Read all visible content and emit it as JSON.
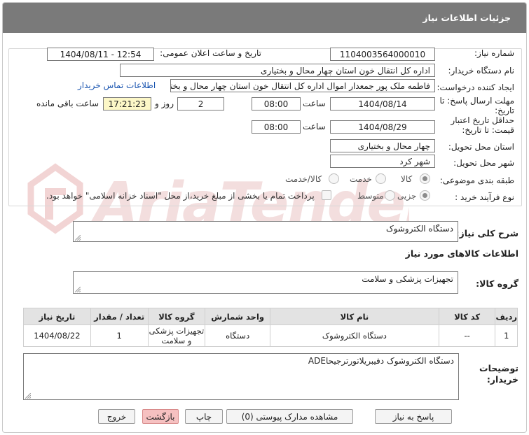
{
  "title": "جزئیات اطلاعات نیاز",
  "fields": {
    "need_number_label": "شماره نیاز:",
    "need_number": "1104003564000010",
    "announce_label": "تاریخ و ساعت اعلان عمومی:",
    "announce_value": "1404/08/11 - 12:54",
    "buyer_org_label": "نام دستگاه خریدار:",
    "buyer_org": "اداره کل انتقال خون استان چهار محال و بختیاری",
    "creator_label": "ایجاد کننده درخواست:",
    "creator": "فاطمه ملک پور جمعدار اموال اداره کل انتقال خون استان چهار محال و بختیاری",
    "contact_link": "اطلاعات تماس خریدار",
    "deadline_label_line1": "مهلت ارسال پاسخ: تا",
    "deadline_label_line2": "تاریخ:",
    "deadline_date": "1404/08/14",
    "time_label": "ساعت",
    "deadline_time": "08:00",
    "days_count": "2",
    "days_label": "روز و",
    "remaining_time": "17:21:23",
    "remaining_label": "ساعت باقی مانده",
    "min_validity_line1": "حداقل تاریخ اعتبار",
    "min_validity_line2": "قیمت: تا تاریخ:",
    "validity_date": "1404/08/29",
    "validity_time": "08:00",
    "province_label": "استان محل تحویل:",
    "province": "چهار محال و بختیاری",
    "city_label": "شهر محل تحویل:",
    "city": "شهر کرد",
    "category_label": "طبقه بندی موضوعی:",
    "category_options": [
      "کالا",
      "خدمت",
      "کالا/خدمت"
    ],
    "process_label": "نوع فرآیند خرید :",
    "process_options": [
      "جزیی",
      "متوسط"
    ],
    "payment_note": "پرداخت تمام یا بخشی از مبلغ خرید،از محل \"اسناد خزانه اسلامی\" خواهد بود."
  },
  "summary_label": "شرح کلی نیاز:",
  "summary": "دستگاه الکتروشوک",
  "goods_info_title": "اطلاعات کالاهای مورد نیاز",
  "goods_group_label": "گروه کالا:",
  "goods_group": "تجهیزات پزشکی و سلامت",
  "table": {
    "headers": [
      "ردیف",
      "کد کالا",
      "نام کالا",
      "واحد شمارش",
      "گروه کالا",
      "تعداد / مقدار",
      "تاریخ نیاز"
    ],
    "rows": [
      [
        "1",
        "--",
        "دستگاه الکتروشوک",
        "دستگاه",
        "تجهیزات پزشکی و سلامت",
        "1",
        "1404/08/22"
      ]
    ]
  },
  "buyer_notes_label_line1": "توضیحات",
  "buyer_notes_label_line2": "خریدار:",
  "buyer_notes": "دستگاه الکتروشوک دفیبریلاتورترجیحاADE",
  "buttons": {
    "reply": "پاسخ به نیاز",
    "attachments": "مشاهده مدارک پیوستی (0)",
    "print": "چاپ",
    "back": "بازگشت",
    "exit": "خروج"
  },
  "colors": {
    "titlebar": "#7a7a7a",
    "link": "#1a55b0",
    "remaining_bg": "#fcf7c7",
    "watermark": "#f0d0d0"
  }
}
